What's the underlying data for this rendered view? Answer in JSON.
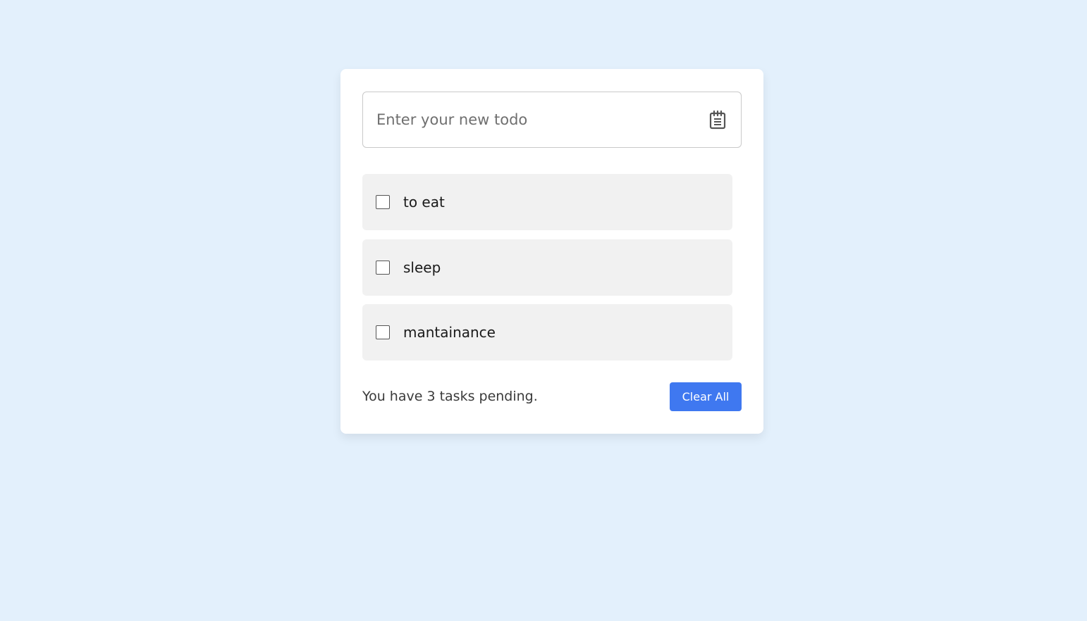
{
  "theme": {
    "page_background": "#e3f0fc",
    "card_background": "#ffffff",
    "item_background": "#f1f1f1",
    "accent": "#3f78f0"
  },
  "input": {
    "value": "",
    "placeholder": "Enter your new todo",
    "icon": "notepad-icon"
  },
  "todos": [
    {
      "label": "to eat",
      "checked": false
    },
    {
      "label": "sleep",
      "checked": false
    },
    {
      "label": "mantainance",
      "checked": false
    }
  ],
  "footer": {
    "pending_text": "You have 3 tasks pending.",
    "clear_label": "Clear All"
  }
}
